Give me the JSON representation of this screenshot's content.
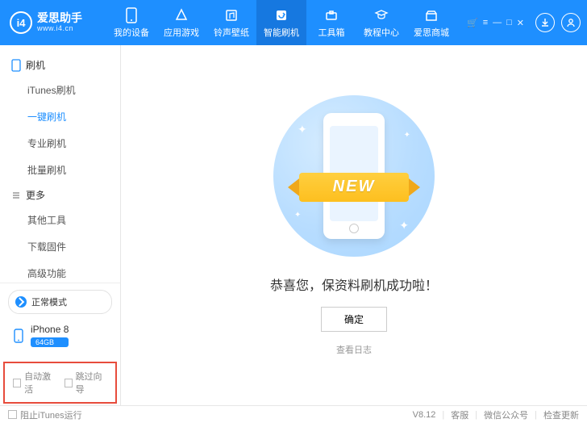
{
  "brand": {
    "name": "爱思助手",
    "url": "www.i4.cn",
    "logo_text": "i4"
  },
  "topnav": [
    {
      "label": "我的设备"
    },
    {
      "label": "应用游戏"
    },
    {
      "label": "铃声壁纸"
    },
    {
      "label": "智能刷机"
    },
    {
      "label": "工具箱"
    },
    {
      "label": "教程中心"
    },
    {
      "label": "爱思商城"
    }
  ],
  "sidebar": {
    "group1": {
      "title": "刷机",
      "items": [
        "iTunes刷机",
        "一键刷机",
        "专业刷机",
        "批量刷机"
      ],
      "active_index": 1
    },
    "group2": {
      "title": "更多",
      "items": [
        "其他工具",
        "下载固件",
        "高级功能"
      ]
    },
    "mode": "正常模式",
    "device": {
      "name": "iPhone 8",
      "storage": "64GB"
    },
    "options": {
      "auto_activate": "自动激活",
      "skip_guide": "跳过向导"
    }
  },
  "main": {
    "ribbon": "NEW",
    "success": "恭喜您，保资料刷机成功啦！",
    "ok": "确定",
    "log": "查看日志"
  },
  "footer": {
    "block_itunes": "阻止iTunes运行",
    "version": "V8.12",
    "links": [
      "客服",
      "微信公众号",
      "检查更新"
    ]
  }
}
